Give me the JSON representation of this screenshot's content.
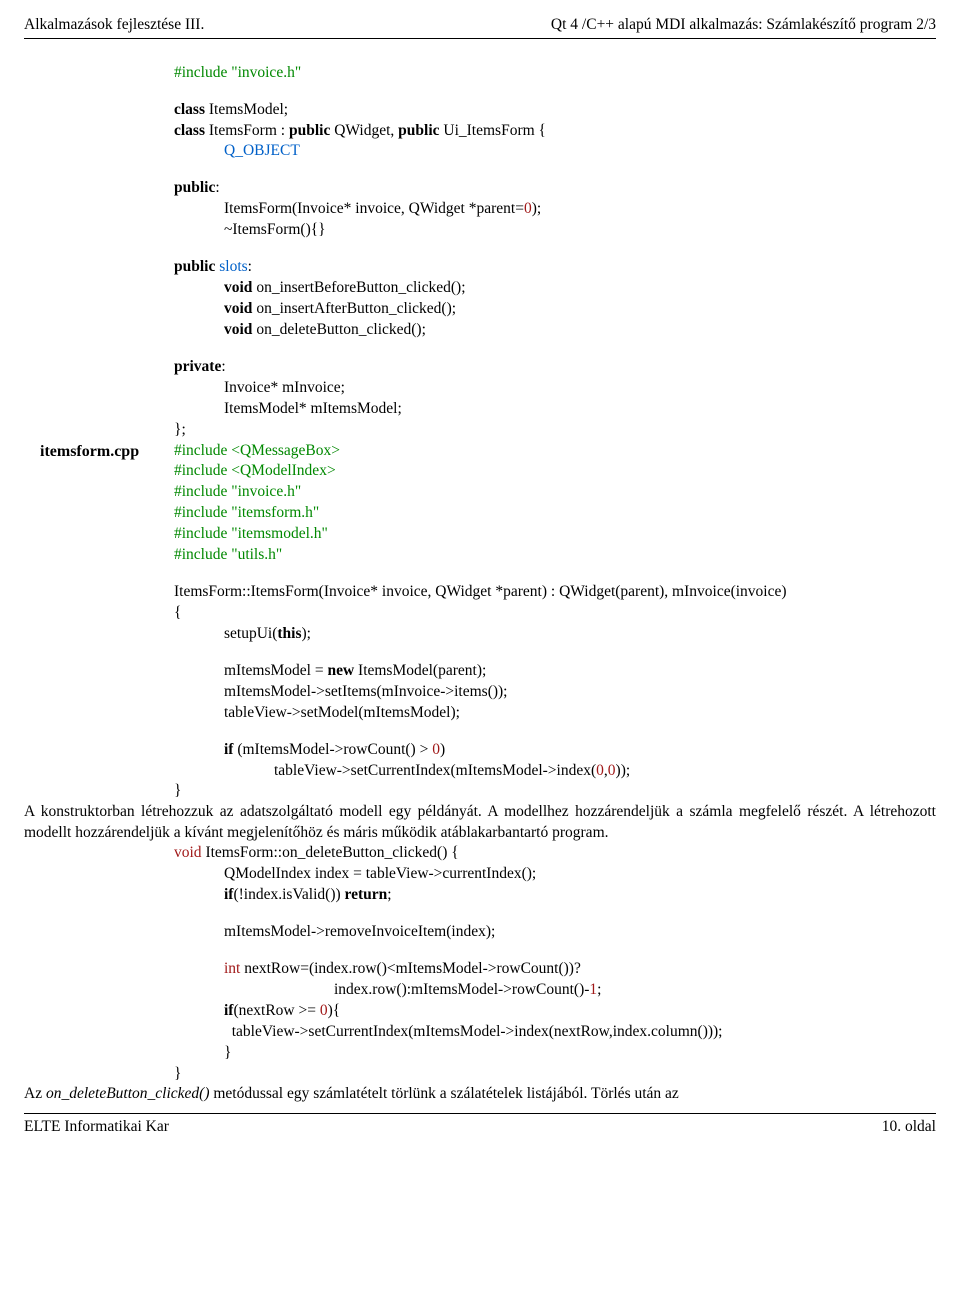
{
  "header": {
    "left": "Alkalmazások fejlesztése III.",
    "right": "Qt 4 /C++ alapú MDI alkalmazás: Számlakészítő program 2/3"
  },
  "footer": {
    "left": "ELTE Informatikai Kar",
    "right": "10. oldal"
  },
  "sideLabel": "itemsform.cpp",
  "code": {
    "l01": "#include \"invoice.h\"",
    "l02a": "class",
    "l02b": " ItemsModel;",
    "l03a": "class",
    "l03b": " ItemsForm : ",
    "l03c": "public",
    "l03d": " QWidget, ",
    "l03e": "public",
    "l03f": " Ui_ItemsForm {",
    "l04": "Q_OBJECT",
    "l05a": "public",
    "l05b": ":",
    "l06a": "ItemsForm(Invoice* invoice, QWidget *parent=",
    "l06b": "0",
    "l06c": ");",
    "l07": "~ItemsForm(){}",
    "l08a": "public",
    "l08b": " slots",
    "l08c": ":",
    "l09a": "void",
    "l09b": " on_insertBeforeButton_clicked();",
    "l10a": "void",
    "l10b": " on_insertAfterButton_clicked();",
    "l11a": "void",
    "l11b": " on_deleteButton_clicked();",
    "l12a": "private",
    "l12b": ":",
    "l13": "Invoice* mInvoice;",
    "l14": "ItemsModel* mItemsModel;",
    "l15": "};",
    "l16": "#include <QMessageBox>",
    "l17": "#include <QModelIndex>",
    "l18": "#include \"invoice.h\"",
    "l19": "#include \"itemsform.h\"",
    "l20": "#include \"itemsmodel.h\"",
    "l21": "#include \"utils.h\"",
    "l22": "ItemsForm::ItemsForm(Invoice* invoice, QWidget *parent) : QWidget(parent), mInvoice(invoice)",
    "l23": "{",
    "l24a": "setupUi(",
    "l24b": "this",
    "l24c": ");",
    "l25a": "mItemsModel = ",
    "l25b": "new",
    "l25c": " ItemsModel(parent);",
    "l26": "mItemsModel->setItems(mInvoice->items());",
    "l27": "tableView->setModel(mItemsModel);",
    "l28a": "if",
    "l28b": " (mItemsModel->rowCount() > ",
    "l28c": "0",
    "l28d": ")",
    "l29a": "tableView->setCurrentIndex(mItemsModel->index(",
    "l29b": "0",
    "l29c": ",",
    "l29d": "0",
    "l29e": "));",
    "l30": "}"
  },
  "para1": "A konstruktorban létrehozzuk az adatszolgáltató modell egy példányát. A modellhez hozzárendeljük a számla megfelelő részét. A létrehozott modellt hozzárendeljük a kívánt megjelenítőhöz és máris működik atáblakarbantartó program.",
  "code2": {
    "l31a": "void",
    "l31b": " ItemsForm::on_deleteButton_clicked() {",
    "l32": "QModelIndex index = tableView->currentIndex();",
    "l33a": "if",
    "l33b": "(!index.isValid()) ",
    "l33c": "return",
    "l33d": ";",
    "l34": "mItemsModel->removeInvoiceItem(index);",
    "l35a": "int",
    "l35b": " nextRow=(index.row()<mItemsModel->rowCount())?",
    "l36a": "index.row():mItemsModel->rowCount()-",
    "l36b": "1",
    "l36c": ";",
    "l37a": "if",
    "l37b": "(nextRow >= ",
    "l37c": "0",
    "l37d": "){",
    "l38": "tableView->setCurrentIndex(mItemsModel->index(nextRow,index.column()));",
    "l39": "}",
    "l40": "}"
  },
  "para2a": "Az ",
  "para2b": "on_deleteButton_clicked()",
  "para2c": "  metódussal egy számlatételt  törlünk a szálatételek listájából. Törlés után az"
}
